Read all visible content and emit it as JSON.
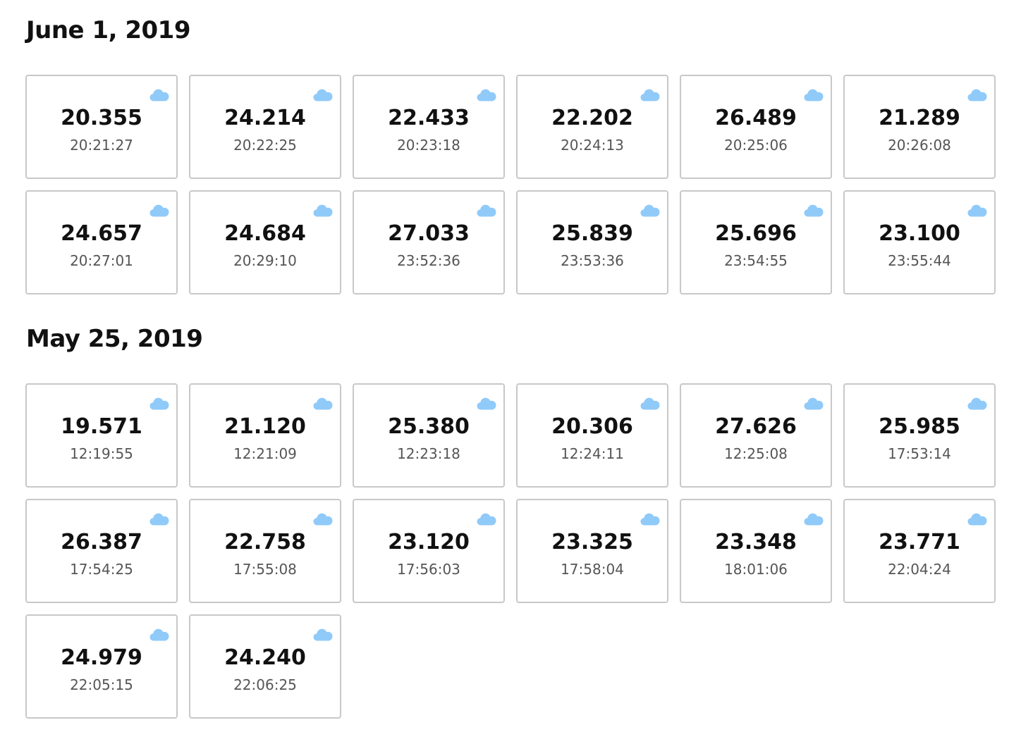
{
  "accent_color": "#90CAF9",
  "icon": "cloud-icon",
  "days": [
    {
      "title": "June 1, 2019",
      "readings": [
        {
          "value": "20.355",
          "time": "20:21:27"
        },
        {
          "value": "24.214",
          "time": "20:22:25"
        },
        {
          "value": "22.433",
          "time": "20:23:18"
        },
        {
          "value": "22.202",
          "time": "20:24:13"
        },
        {
          "value": "26.489",
          "time": "20:25:06"
        },
        {
          "value": "21.289",
          "time": "20:26:08"
        },
        {
          "value": "24.657",
          "time": "20:27:01"
        },
        {
          "value": "24.684",
          "time": "20:29:10"
        },
        {
          "value": "27.033",
          "time": "23:52:36"
        },
        {
          "value": "25.839",
          "time": "23:53:36"
        },
        {
          "value": "25.696",
          "time": "23:54:55"
        },
        {
          "value": "23.100",
          "time": "23:55:44"
        }
      ]
    },
    {
      "title": "May 25, 2019",
      "readings": [
        {
          "value": "19.571",
          "time": "12:19:55"
        },
        {
          "value": "21.120",
          "time": "12:21:09"
        },
        {
          "value": "25.380",
          "time": "12:23:18"
        },
        {
          "value": "20.306",
          "time": "12:24:11"
        },
        {
          "value": "27.626",
          "time": "12:25:08"
        },
        {
          "value": "25.985",
          "time": "17:53:14"
        },
        {
          "value": "26.387",
          "time": "17:54:25"
        },
        {
          "value": "22.758",
          "time": "17:55:08"
        },
        {
          "value": "23.120",
          "time": "17:56:03"
        },
        {
          "value": "23.325",
          "time": "17:58:04"
        },
        {
          "value": "23.348",
          "time": "18:01:06"
        },
        {
          "value": "23.771",
          "time": "22:04:24"
        },
        {
          "value": "24.979",
          "time": "22:05:15"
        },
        {
          "value": "24.240",
          "time": "22:06:25"
        }
      ]
    }
  ]
}
